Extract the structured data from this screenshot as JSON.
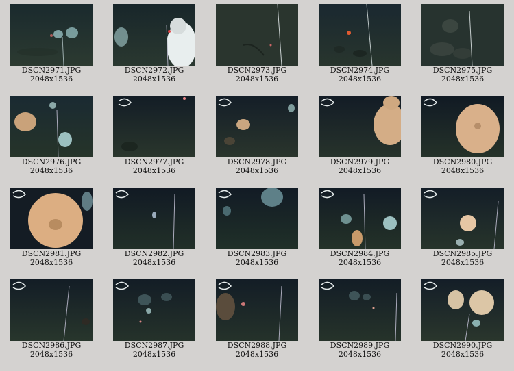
{
  "gallery": {
    "items": [
      {
        "filename": "DSCN2971.JPG",
        "dimensions": "2048x1536"
      },
      {
        "filename": "DSCN2972.JPG",
        "dimensions": "2048x1536"
      },
      {
        "filename": "DSCN2973.JPG",
        "dimensions": "2048x1536"
      },
      {
        "filename": "DSCN2974.JPG",
        "dimensions": "2048x1536"
      },
      {
        "filename": "DSCN2975.JPG",
        "dimensions": "2048x1536"
      },
      {
        "filename": "DSCN2976.JPG",
        "dimensions": "2048x1536"
      },
      {
        "filename": "DSCN2977.JPG",
        "dimensions": "2048x1536"
      },
      {
        "filename": "DSCN2978.JPG",
        "dimensions": "2048x1536"
      },
      {
        "filename": "DSCN2979.JPG",
        "dimensions": "2048x1536"
      },
      {
        "filename": "DSCN2980.JPG",
        "dimensions": "2048x1536"
      },
      {
        "filename": "DSCN2981.JPG",
        "dimensions": "2048x1536"
      },
      {
        "filename": "DSCN2982.JPG",
        "dimensions": "2048x1536"
      },
      {
        "filename": "DSCN2983.JPG",
        "dimensions": "2048x1536"
      },
      {
        "filename": "DSCN2984.JPG",
        "dimensions": "2048x1536"
      },
      {
        "filename": "DSCN2985.JPG",
        "dimensions": "2048x1536"
      },
      {
        "filename": "DSCN2986.JPG",
        "dimensions": "2048x1536"
      },
      {
        "filename": "DSCN2987.JPG",
        "dimensions": "2048x1536"
      },
      {
        "filename": "DSCN2988.JPG",
        "dimensions": "2048x1536"
      },
      {
        "filename": "DSCN2989.JPG",
        "dimensions": "2048x1536"
      },
      {
        "filename": "DSCN2990.JPG",
        "dimensions": "2048x1536"
      }
    ]
  },
  "colors": {
    "page_background": "#d4d2d0",
    "caption_text": "#111111",
    "water_dark": "#14202a",
    "seafloor": "#2a3a30",
    "sponge_orange": "#d9b08a",
    "sponge_pale": "#8fb8b8"
  }
}
